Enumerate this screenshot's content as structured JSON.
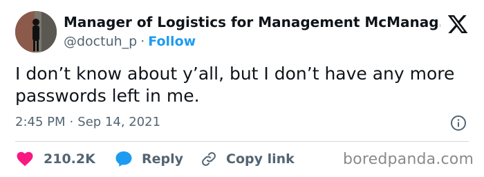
{
  "author": {
    "display_name": "Manager of Logistics for Management McManag...",
    "handle": "@doctuh_p",
    "separator": "·",
    "follow_label": "Follow"
  },
  "tweet": {
    "text": "I don’t know about y’all, but I don’t have any more passwords left in me.",
    "time": "2:45 PM",
    "date": "Sep 14, 2021",
    "meta_separator": "·"
  },
  "actions": {
    "like_count": "210.2K",
    "reply_label": "Reply",
    "copy_link_label": "Copy link"
  },
  "watermark": "boredpanda.com",
  "colors": {
    "accent": "#1d9bf0",
    "like": "#f91880",
    "secondary_text": "#536471"
  },
  "icons": [
    "x-logo-icon",
    "info-icon",
    "heart-icon",
    "reply-bubble-icon",
    "link-icon"
  ]
}
